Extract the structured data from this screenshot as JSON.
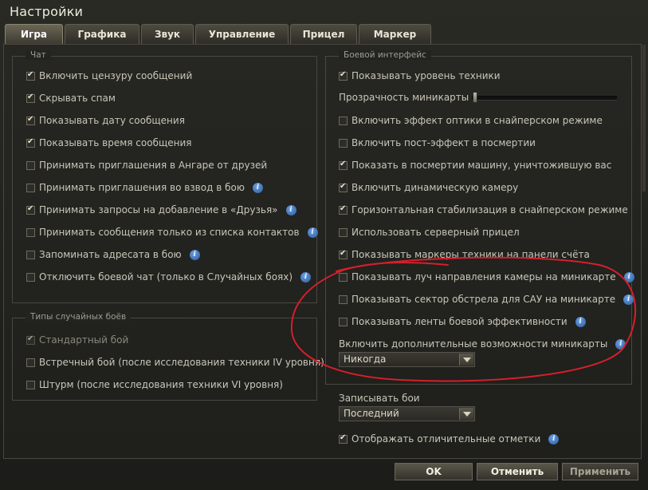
{
  "window": {
    "title": "Настройки"
  },
  "tabs": [
    {
      "label": "Игра",
      "active": true
    },
    {
      "label": "Графика",
      "active": false
    },
    {
      "label": "Звук",
      "active": false
    },
    {
      "label": "Управление",
      "active": false
    },
    {
      "label": "Прицел",
      "active": false
    },
    {
      "label": "Маркер",
      "active": false
    }
  ],
  "chat": {
    "legend": "Чат",
    "items": [
      {
        "label": "Включить цензуру сообщений",
        "checked": true,
        "info": false
      },
      {
        "label": "Скрывать спам",
        "checked": true,
        "info": false
      },
      {
        "label": "Показывать дату сообщения",
        "checked": true,
        "info": false
      },
      {
        "label": "Показывать время сообщения",
        "checked": true,
        "info": false
      },
      {
        "label": "Принимать приглашения в Ангаре от друзей",
        "checked": false,
        "info": false
      },
      {
        "label": "Принимать приглашения во взвод в бою",
        "checked": false,
        "info": true
      },
      {
        "label": "Принимать запросы на добавление в «Друзья»",
        "checked": true,
        "info": true
      },
      {
        "label": "Принимать сообщения только из списка контактов",
        "checked": false,
        "info": true
      },
      {
        "label": "Запоминать адресата в бою",
        "checked": false,
        "info": true
      },
      {
        "label": "Отключить боевой чат (только в Случайных боях)",
        "checked": false,
        "info": true
      }
    ]
  },
  "battle_types": {
    "legend": "Типы случайных боёв",
    "items": [
      {
        "label": "Стандартный бой",
        "checked": true,
        "disabled": true
      },
      {
        "label": "Встречный бой (после исследования техники IV уровня)",
        "checked": false,
        "disabled": false
      },
      {
        "label": "Штурм (после исследования техники VI уровня)",
        "checked": false,
        "disabled": false
      }
    ]
  },
  "battle_ui": {
    "legend": "Боевой интерфейс",
    "show_tech_level": {
      "label": "Показывать уровень техники",
      "checked": true
    },
    "minimap_transparency": {
      "label": "Прозрачность миникарты",
      "value": 0
    },
    "items": [
      {
        "label": "Включить эффект оптики в снайперском режиме",
        "checked": false,
        "info": false
      },
      {
        "label": "Включить пост-эффект в посмертии",
        "checked": false,
        "info": false
      },
      {
        "label": "Показать в посмертии машину, уничтожившую вас",
        "checked": true,
        "info": false
      },
      {
        "label": "Включить динамическую камеру",
        "checked": true,
        "info": false
      },
      {
        "label": "Горизонтальная стабилизация в снайперском режиме",
        "checked": true,
        "info": false
      },
      {
        "label": "Использовать серверный прицел",
        "checked": false,
        "info": false
      },
      {
        "label": "Показывать маркеры техники на панели счёта",
        "checked": true,
        "info": false
      },
      {
        "label": "Показывать луч направления камеры на миникарте",
        "checked": false,
        "info": true
      },
      {
        "label": "Показывать сектор обстрела для САУ на миникарте",
        "checked": false,
        "info": true
      },
      {
        "label": "Показывать ленты боевой эффективности",
        "checked": false,
        "info": true
      }
    ],
    "minimap_extra": {
      "label": "Включить дополнительные возможности миникарты",
      "value": "Никогда"
    }
  },
  "replays": {
    "label": "Записывать бои",
    "value": "Последний"
  },
  "marks": {
    "label": "Отображать отличительные отметки",
    "checked": true
  },
  "buttons": {
    "ok": "OK",
    "cancel": "Отменить",
    "apply": "Применить"
  },
  "colors": {
    "annotation": "#d4202a",
    "info_icon": "#3a6fbf"
  }
}
